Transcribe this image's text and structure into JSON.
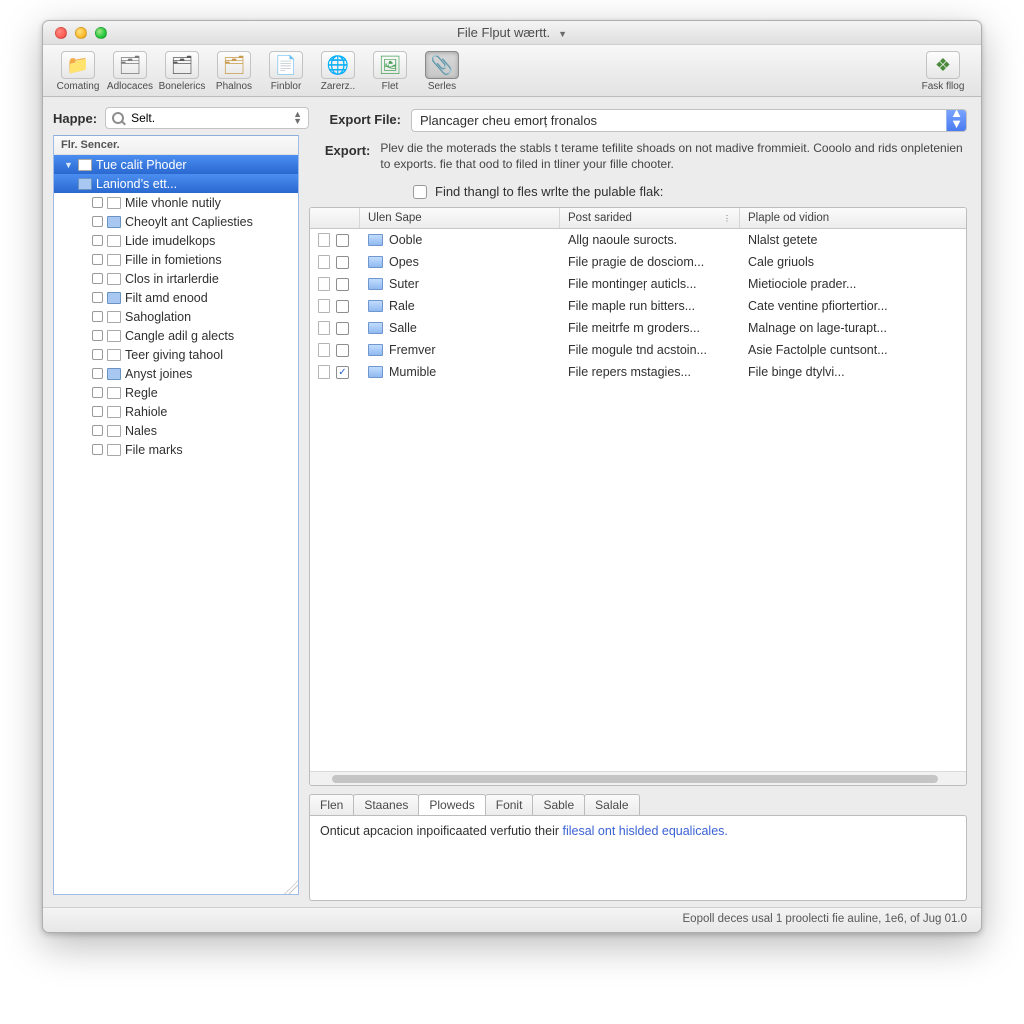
{
  "window": {
    "title": "File Flput wærtt."
  },
  "toolbar": {
    "items": [
      {
        "label": "Comating",
        "icon": "📁",
        "color": "#6aa8ef"
      },
      {
        "label": "Adlocaces",
        "icon": "🗂",
        "color": "#7a7a7a"
      },
      {
        "label": "Bonelerics",
        "icon": "🗂",
        "color": "#5a5a5a"
      },
      {
        "label": "Phalnos",
        "icon": "🗂",
        "color": "#c79b4a"
      },
      {
        "label": "Finblor",
        "icon": "📄",
        "color": "#5aa2e6"
      },
      {
        "label": "Zarerz..",
        "icon": "🌐",
        "color": "#7a88b5"
      },
      {
        "label": "Flet",
        "icon": "🖼",
        "color": "#4aa35a"
      },
      {
        "label": "Serles",
        "icon": "📎",
        "color": "#9a9a9a",
        "selected": true
      }
    ],
    "right": {
      "label": "Fask fllog",
      "icon": "❖",
      "color": "#4a8a3a"
    }
  },
  "sidebar": {
    "search_label": "Happe:",
    "search_value": "Selt.",
    "header": "Flr. Sencer.",
    "nodes": [
      {
        "depth": 0,
        "label": "Tue calit Phoder",
        "sel": true,
        "disc": "▼",
        "icon": "file"
      },
      {
        "depth": 0,
        "label": "Laniond’s ett...",
        "sel": true,
        "disc": "",
        "icon": "fold"
      },
      {
        "depth": 1,
        "label": "Mile vhonle nutily",
        "icon": "file",
        "chk": true
      },
      {
        "depth": 1,
        "label": "Cheoylt ant Capliesties",
        "icon": "fold",
        "chk": true
      },
      {
        "depth": 1,
        "label": "Lide imudelkops",
        "icon": "file",
        "chk": true
      },
      {
        "depth": 1,
        "label": "Fille in fomietions",
        "icon": "file",
        "chk": true
      },
      {
        "depth": 1,
        "label": "Clos in irtarlerdie",
        "icon": "file",
        "chk": true
      },
      {
        "depth": 1,
        "label": "Filt amd enood",
        "icon": "fold",
        "chk": true
      },
      {
        "depth": 1,
        "label": "Sahoglation",
        "icon": "file",
        "chk": true
      },
      {
        "depth": 1,
        "label": "Cangle adil g alects",
        "icon": "file",
        "chk": true
      },
      {
        "depth": 1,
        "label": "Teer giving tahool",
        "icon": "file",
        "chk": true
      },
      {
        "depth": 1,
        "label": "Anyst joines",
        "icon": "fold",
        "chk": true
      },
      {
        "depth": 1,
        "label": "Regle",
        "icon": "file",
        "chk": true
      },
      {
        "depth": 1,
        "label": "Rahiole",
        "icon": "file",
        "chk": true
      },
      {
        "depth": 1,
        "label": "Nales",
        "icon": "file",
        "chk": true
      },
      {
        "depth": 1,
        "label": "File marks",
        "icon": "file",
        "chk": true
      }
    ]
  },
  "form": {
    "export_file_label": "Export File:",
    "export_file_value": "Plancager cheu emorț fronalos",
    "export_label": "Export:",
    "export_desc": "Plev die the moterads the stabls t terame tefilite shoads on not madive frommieit. Cooolo and rids onpletenien to exports. fie that ood to filed in tliner your fille chooter.",
    "checkbox_label": "Find thangl to fles wrlte the pulable flak:"
  },
  "table": {
    "headers": {
      "c0": "",
      "c1": "Ulen Sape",
      "c2": "Post sarided",
      "c3": "Plaple od vidion"
    },
    "rows": [
      {
        "chk": false,
        "name": "Ooble",
        "c2": "Allg naoule surocts.",
        "c3": "Nlalst getete"
      },
      {
        "chk": false,
        "name": "Opes",
        "c2": "File pragie de dosciom...",
        "c3": "Cale griuols"
      },
      {
        "chk": false,
        "name": "Suter",
        "c2": "File montingeŗ auticls...",
        "c3": "Mietiociole prader..."
      },
      {
        "chk": false,
        "name": "Rale",
        "c2": "File maple run bitters...",
        "c3": "Cate ventine pfiortertior..."
      },
      {
        "chk": false,
        "name": "Salle",
        "c2": "File meitrfe m groders...",
        "c3": "Malnage on lage-turapt..."
      },
      {
        "chk": false,
        "name": "Fremver",
        "c2": "File mogule tnd acstoin...",
        "c3": "Asie Factolple cuntsont..."
      },
      {
        "chk": true,
        "name": "Mumible",
        "c2": "File repers mstagies...",
        "c3": "File binge dtylvi..."
      }
    ]
  },
  "tabs": {
    "items": [
      "Flen",
      "Staanes",
      "Ploweds",
      "Fonit",
      "Sable",
      "Salale"
    ],
    "active_index": 2,
    "detail_plain": "Onticut apcacion inpoificaated verfutio their ",
    "detail_link": "filesal ont hislded equalicales."
  },
  "status": "Eopoll deces usal 1 proolecti fie auline, 1e6, of Jug 01.0"
}
